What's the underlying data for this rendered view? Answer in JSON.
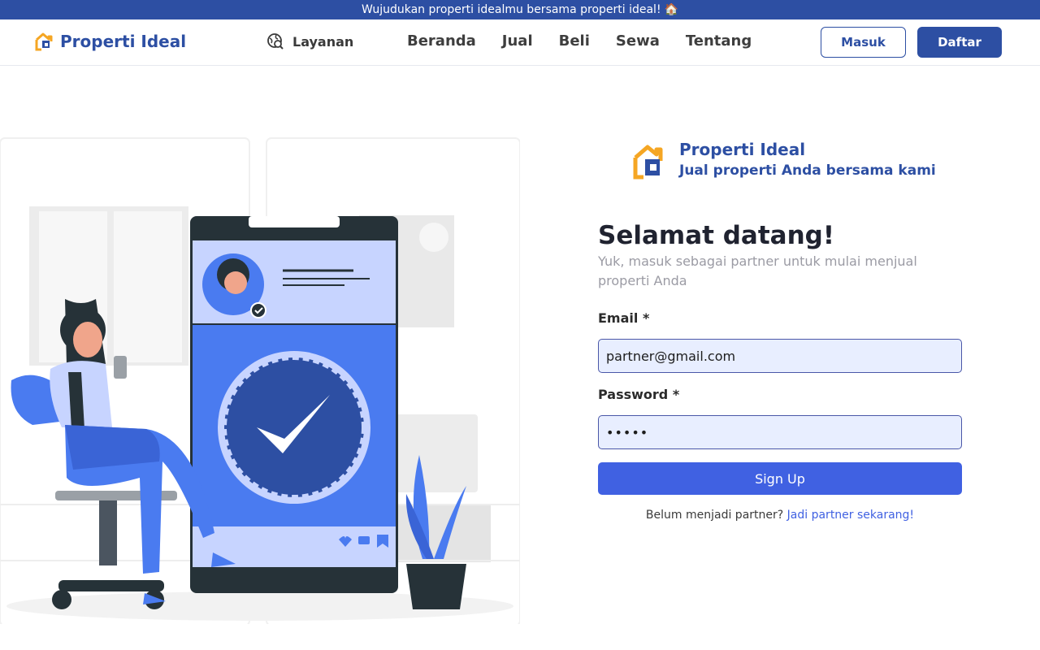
{
  "announcement": {
    "text": "Wujudukan properti idealmu bersama properti ideal!",
    "emoji": "🏠"
  },
  "nav": {
    "brand": "Properti Ideal",
    "services_label": "Layanan",
    "links": [
      "Beranda",
      "Jual",
      "Beli",
      "Sewa",
      "Tentang"
    ],
    "login_label": "Masuk",
    "register_label": "Daftar"
  },
  "colors": {
    "primary": "#2d4fa3",
    "accent": "#4061e2",
    "logo_yellow": "#f5a623",
    "input_bg": "#e8eeff"
  },
  "form": {
    "brand_title": "Properti Ideal",
    "brand_tagline": "Jual properti Anda bersama kami",
    "heading": "Selamat datang!",
    "subtitle": "Yuk, masuk sebagai partner untuk mulai menjual properti Anda",
    "email_label": "Email *",
    "email_value": "partner@gmail.com",
    "password_label": "Password *",
    "password_value": "•••••",
    "submit_label": "Sign Up",
    "footer_text": "Belum menjadi partner?",
    "footer_link": "Jadi partner sekarang!"
  },
  "icons": {
    "logo": "house-logo-icon",
    "services": "globe-search-icon"
  }
}
